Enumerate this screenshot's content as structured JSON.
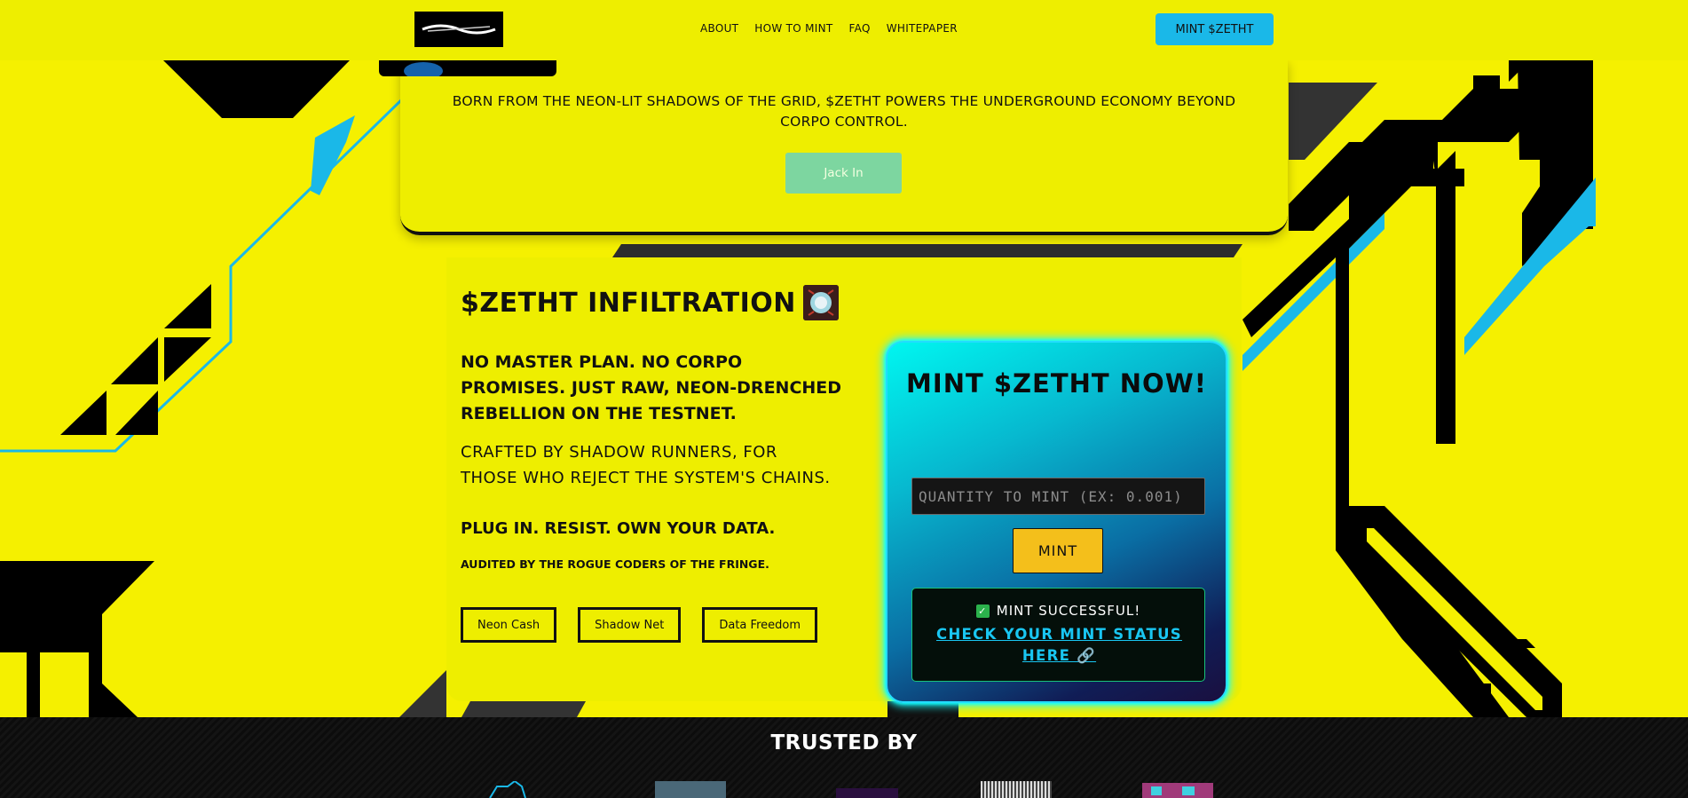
{
  "nav": {
    "links": [
      "ABOUT",
      "HOW TO MINT",
      "FAQ",
      "WHITEPAPER"
    ],
    "cta": "MINT $ZETHT"
  },
  "hero": {
    "text": "BORN FROM THE NEON-LIT SHADOWS OF THE GRID, $ZETHT POWERS THE UNDERGROUND ECONOMY BEYOND CORPO CONTROL.",
    "button": "Jack In"
  },
  "infiltration": {
    "title": "$ZETHT INFILTRATION",
    "lead": "NO MASTER PLAN. NO CORPO PROMISES. JUST RAW, NEON-DRENCHED REBELLION ON THE TESTNET.",
    "paragraph": "CRAFTED BY SHADOW RUNNERS, FOR THOSE WHO REJECT THE SYSTEM'S CHAINS.",
    "emphasis": "PLUG IN. RESIST. OWN YOUR DATA.",
    "audit": "AUDITED BY THE ROGUE CODERS OF THE FRINGE.",
    "tags": [
      "Neon Cash",
      "Shadow Net",
      "Data Freedom"
    ]
  },
  "mint": {
    "heading": "MINT $ZETHT NOW!",
    "input_placeholder": "QUANTITY TO MINT (EX: 0.001)",
    "button": "MINT",
    "status": "MINT SUCCESSFUL!",
    "status_icon": "check-icon",
    "link": "CHECK YOUR MINT STATUS HERE 🔗"
  },
  "trusted": {
    "title": "TRUSTED BY"
  },
  "colors": {
    "background": "#f5f000",
    "accent_cyan": "#1ab8e8",
    "mint_button": "#f4bf1b",
    "jack_button": "#7dd6a0"
  }
}
